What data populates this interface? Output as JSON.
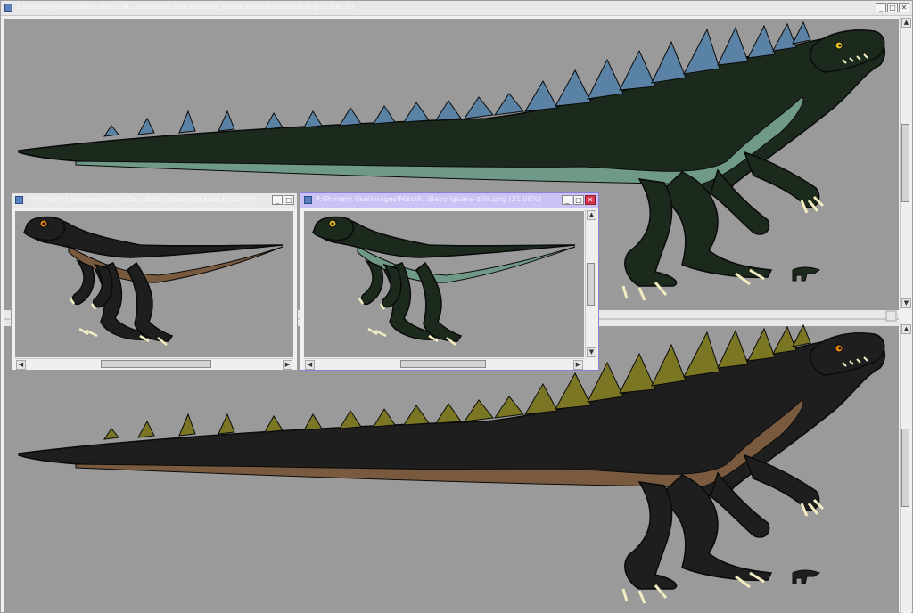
{
  "windows": {
    "main": {
      "title": "F:\\Primary Use\\Images\\Misc\\PNG pics\\Dinos and Kaiju\\My characters\\iguana-zilla.png (15.42%)"
    },
    "sai": {
      "title": "F:\\Primary Use\\Images\\Misc\\Se...\\Baby iguana-zilla.sai (31.08%)"
    },
    "png": {
      "title": "F:\\Primary Use\\Images\\Misc\\P...\\Baby iguana-zilla.png (31.08%)"
    }
  },
  "controls": {
    "minimize": "_",
    "maximize": "□",
    "close": "✕",
    "up": "▲",
    "down": "▼",
    "left": "◀",
    "right": "▶"
  },
  "icons": {
    "app": "image-viewer-icon"
  },
  "colors": {
    "canvas": "#9a9a9a",
    "green_body": "#1c2a1e",
    "green_belly": "#6f9a88",
    "green_spikes": "#5a82a4",
    "black_body": "#1e1e1e",
    "black_belly": "#7a5a3e",
    "olive_spikes": "#7a7624",
    "eye_yellow": "#e0c020",
    "eye_orange": "#f08a10",
    "claws": "#f2ecc0"
  }
}
